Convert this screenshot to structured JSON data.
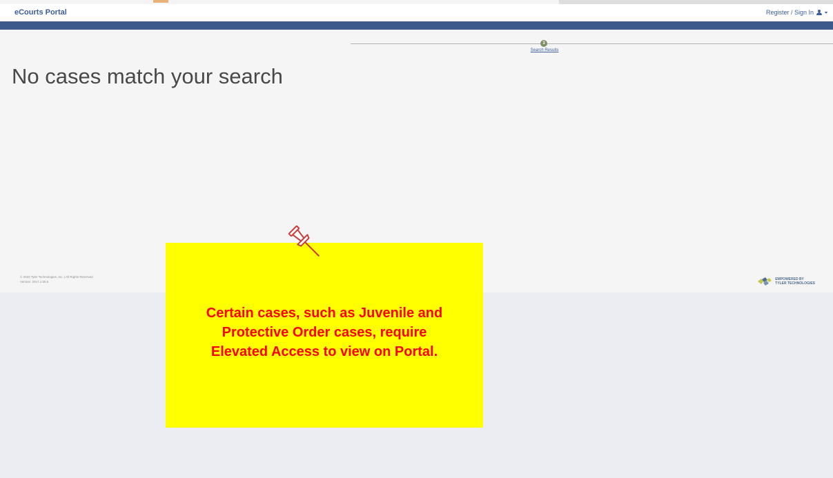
{
  "header": {
    "brand": "eCourts Portal",
    "sign_in_label": "Register / Sign In"
  },
  "progress": {
    "step_number": "3",
    "step_label": "Search Results"
  },
  "main": {
    "heading": "No cases match your search"
  },
  "footer": {
    "copyright": "© 2023 Tyler Technologies, Inc. | All Rights Reserved",
    "version": "Version: 2017.1.55.5",
    "logo_line1": "EMPOWERED BY",
    "logo_line2": "TYLER TECHNOLOGIES"
  },
  "callout": {
    "line1": "Certain cases, such as Juvenile and",
    "line2": "Protective Order cases, require",
    "line3": "Elevated Access to view on Portal."
  },
  "colors": {
    "brand_blue": "#3c5c9c",
    "navbar": "#3d5a8c",
    "callout_bg": "#ffff00",
    "callout_text": "#ff0000"
  }
}
